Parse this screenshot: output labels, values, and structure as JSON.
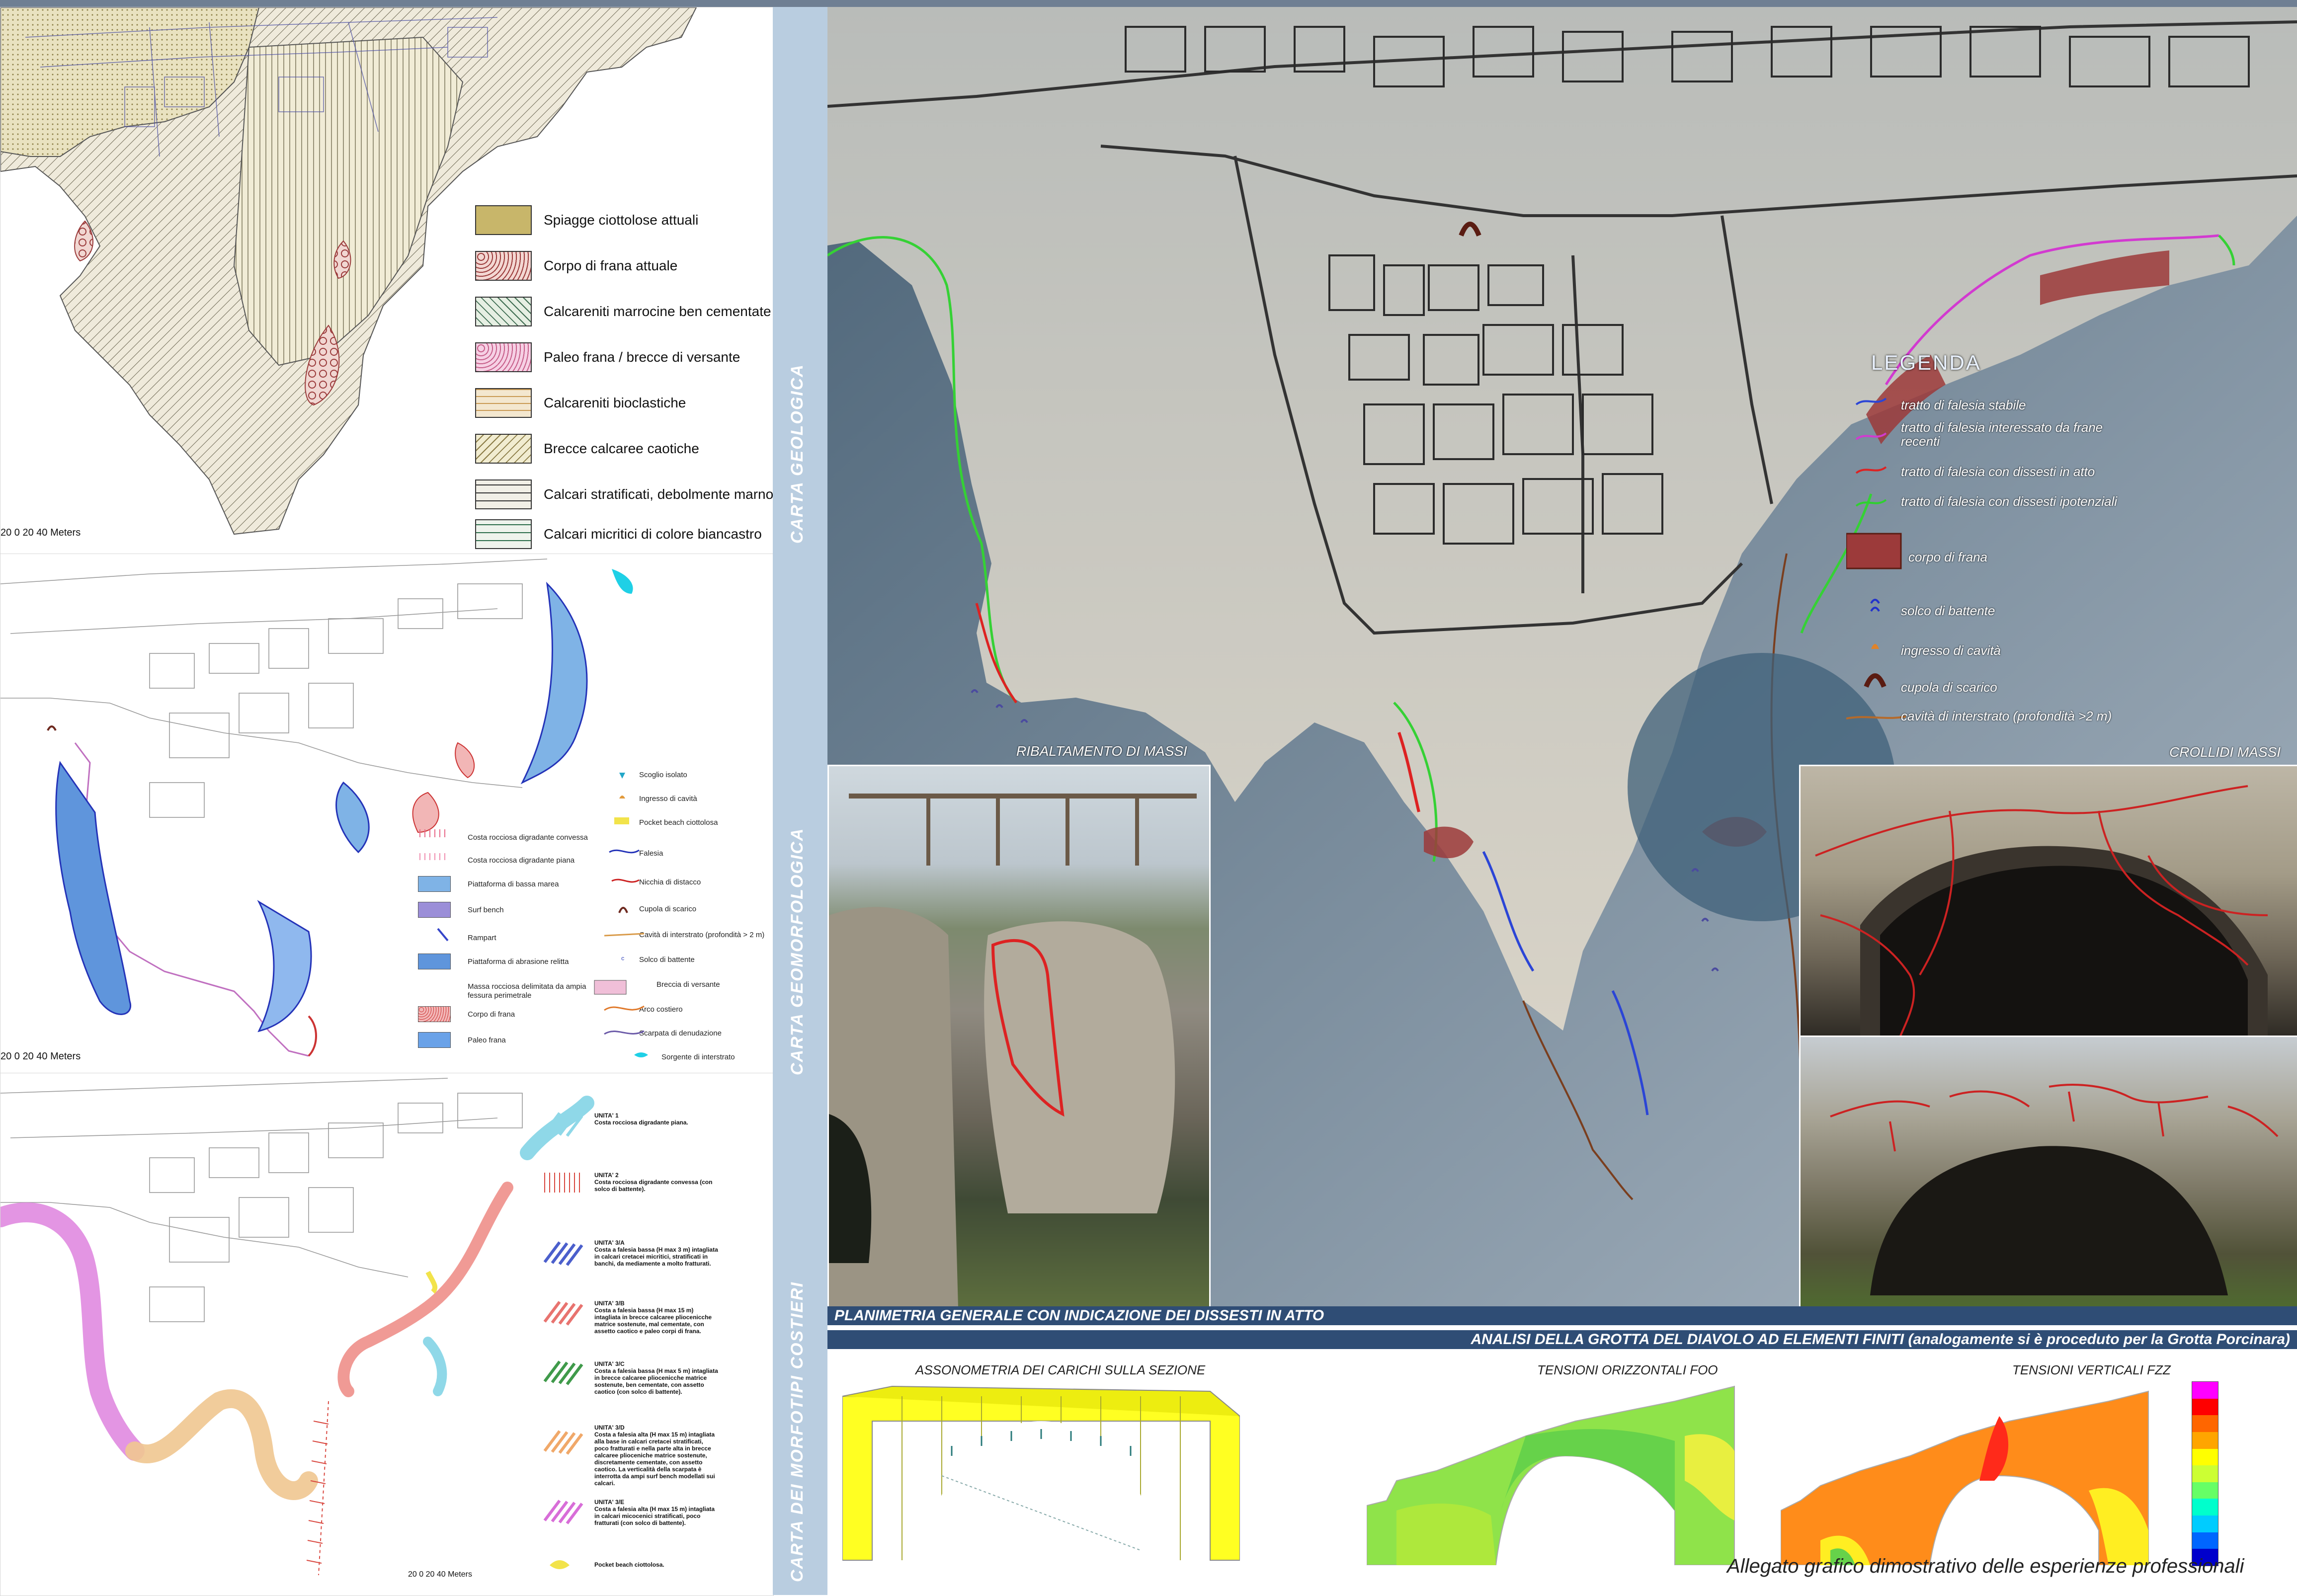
{
  "section_labels": {
    "geologica": "CARTA GEOLOGICA",
    "geomorfologica": "CARTA GEOMORFOLOGICA",
    "morfotipi": "CARTA DEI MORFOTIPI COSTIERI"
  },
  "geo_legend": [
    {
      "label": "Spiagge ciottolose attuali",
      "color": "#c8b66a"
    },
    {
      "label": "Corpo di frana attuale",
      "color": "#d88a86"
    },
    {
      "label": "Calcareniti marrocine ben cementate",
      "color": "#e6efe3"
    },
    {
      "label": "Paleo frana / brecce di versante",
      "color": "#c75f8a"
    },
    {
      "label": "Calcareniti bioclastiche",
      "color": "#f3e7cf"
    },
    {
      "label": "Brecce calcaree caotiche",
      "color": "#e8dcb2"
    },
    {
      "label": "Calcari stratificati, debolmente marnosi",
      "color": "#f1efe6"
    },
    {
      "label": "Calcari micritici di colore biancastro",
      "color": "#eef3ec"
    }
  ],
  "scale_labels": {
    "geo": "20  0   20   40  Meters",
    "geom": "20  0   20   40  Meters",
    "morf": "20  0   20   40  Meters"
  },
  "geom_legend_right": [
    {
      "label": "Scoglio isolato",
      "color": "#23a7c8"
    },
    {
      "label": "Ingresso di cavità",
      "color": "#e29a3c"
    },
    {
      "label": "Pocket beach ciottolosa",
      "color": "#f2e34a"
    },
    {
      "label": "Falesia",
      "color": "#2433b8"
    },
    {
      "label": "Nicchia di distacco",
      "color": "#cc2222"
    },
    {
      "label": "Cupola di scarico",
      "color": "#6e2a20"
    },
    {
      "label": "Cavità di interstrato (profondità > 2 m)",
      "color": "#d99b4a"
    },
    {
      "label": "Solco di battente",
      "color": "#3344bb"
    },
    {
      "label": "Breccia di versante",
      "color": "#f0bfd8"
    },
    {
      "label": "Arco costiero",
      "color": "#e07a2c"
    },
    {
      "label": "Scarpata di denudazione",
      "color": "#6b5aa8"
    },
    {
      "label": "Sorgente di interstrato",
      "color": "#1fd0e6"
    }
  ],
  "geom_legend_left": [
    {
      "label": "Costa rocciosa digradante convessa",
      "color": "#e86a8a"
    },
    {
      "label": "Costa rocciosa digradante piana",
      "color": "#f08fb0"
    },
    {
      "label": "Piattaforma di bassa marea",
      "color": "#7fb3e6"
    },
    {
      "label": "Surf bench",
      "color": "#9b8ed8"
    },
    {
      "label": "Rampart",
      "color": "#3545c9"
    },
    {
      "label": "Piattaforma di abrasione relitta",
      "color": "#5f95dc"
    },
    {
      "label": "Massa rocciosa delimitata da ampia fessura perimetrale",
      "color": "#cc3333"
    },
    {
      "label": "Corpo di frana",
      "color": "#f2b6b6"
    },
    {
      "label": "Paleo frana",
      "color": "#6aa2e8"
    }
  ],
  "morf_units": [
    {
      "title": "UNITA' 1",
      "text": "Costa rocciosa digradante piana.",
      "color": "#8fd8e8"
    },
    {
      "title": "UNITA' 2",
      "text": "Costa rocciosa digradante convessa (con solco di battente).",
      "color": "#d9473f"
    },
    {
      "title": "UNITA' 3/A",
      "text": "Costa a falesia bassa (H max 3 m) intagliata in calcari cretacei micritici, stratificati in banchi, da mediamente a molto fratturati.",
      "color": "#4b5fcc"
    },
    {
      "title": "UNITA' 3/B",
      "text": "Costa a falesia bassa (H max 15 m) intagliata in brecce calcaree pliocenicche matrice sostenute, mal cementate, con assetto caotico e paleo corpi di frana.",
      "color": "#e8736f"
    },
    {
      "title": "UNITA' 3/C",
      "text": "Costa a falesia bassa (H max 5 m) intagliata in brecce calcaree pliocenicche matrice sostenute, ben cementate, con assetto caotico (con solco di battente).",
      "color": "#3f9a4a"
    },
    {
      "title": "UNITA' 3/D",
      "text": "Costa a falesia alta (H max 15 m) intagliata alla base in calcari cretacei stratificati, poco fratturati e nella parte alta in brecce calcaree plioceniche matrice sostenute, discretamente cementate, con assetto caotico. La verticalità della scarpata è interrotta da ampi surf bench modellati sui calcari.",
      "color": "#f0a869"
    },
    {
      "title": "UNITA' 3/E",
      "text": "Costa a falesia alta (H max 15 m) intagliata in calcari micocenici stratificati, poco fratturati (con solco di battente).",
      "color": "#d86ed8"
    },
    {
      "title": "",
      "text": "Pocket beach ciottolosa.",
      "color": "#f2e34a"
    }
  ],
  "legenda": {
    "title": "LEGENDA",
    "items": [
      {
        "label": "tratto di falesia stabile",
        "color": "#2b45d6"
      },
      {
        "label": "tratto di falesia interessato da frane recenti",
        "color": "#d23ad0"
      },
      {
        "label": "tratto di falesia con dissesti in atto",
        "color": "#dd2222"
      },
      {
        "label": "tratto di falesia con dissesti ipotenziali",
        "color": "#2ed12e"
      },
      {
        "label": "corpo di frana",
        "color": "#9c3a3a"
      },
      {
        "label": "solco di battente",
        "color": "#2233cc"
      },
      {
        "label": "ingresso di cavità",
        "color": "#e0832a"
      },
      {
        "label": "cupola di scarico",
        "color": "#5a1c12"
      },
      {
        "label": "cavità di interstrato (profondità >2 m)",
        "color": "#b56a2a"
      }
    ]
  },
  "photos": {
    "ribaltamento": "RIBALTAMENTO DI MASSI",
    "crolli": "CROLLIDI MASSI"
  },
  "bands": {
    "planimetria": "PLANIMETRIA GENERALE CON INDICAZIONE DEI DISSESTI IN ATTO",
    "analisi": "ANALISI DELLA GROTTA DEL DIAVOLO AD ELEMENTI FINITI (analogamente si è proceduto per la Grotta Porcinara)"
  },
  "fem": {
    "assonometria": "ASSONOMETRIA DEI CARICHI SULLA SEZIONE",
    "orizzontali": "TENSIONI ORIZZONTALI FOO",
    "verticali": "TENSIONI VERTICALI FZZ"
  },
  "colorbar_colors": [
    "#ff00ff",
    "#ff0000",
    "#ff6600",
    "#ffa500",
    "#ffff00",
    "#ccff33",
    "#66ff66",
    "#00ffcc",
    "#00ccff",
    "#0066ff",
    "#0000cc"
  ],
  "footer": "Allegato grafico dimostrativo delle esperienze professionali"
}
